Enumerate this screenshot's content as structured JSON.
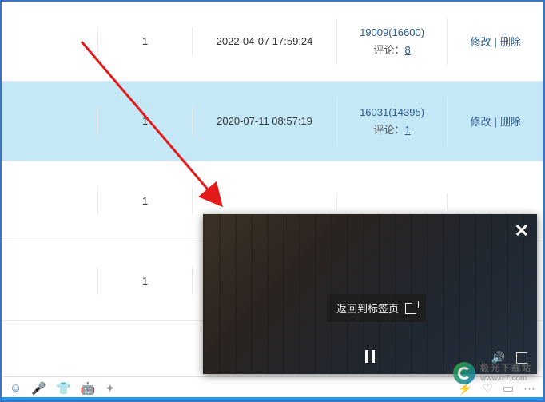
{
  "rows": [
    {
      "count": "1",
      "datetime": "2022-04-07 17:59:24",
      "stats": "19009(16600)",
      "comment_label": "评论：",
      "comment_count": "8",
      "edit": "修改",
      "delete": "删除"
    },
    {
      "count": "1",
      "datetime": "2020-07-11 08:57:19",
      "stats": "16031(14395)",
      "comment_label": "评论：",
      "comment_count": "1",
      "edit": "修改",
      "delete": "删除"
    },
    {
      "count": "1"
    },
    {
      "count": "1"
    }
  ],
  "video": {
    "tooltip": "返回到标签页"
  },
  "watermark": {
    "name": "极光下载站",
    "url": "www.lz7.com"
  }
}
